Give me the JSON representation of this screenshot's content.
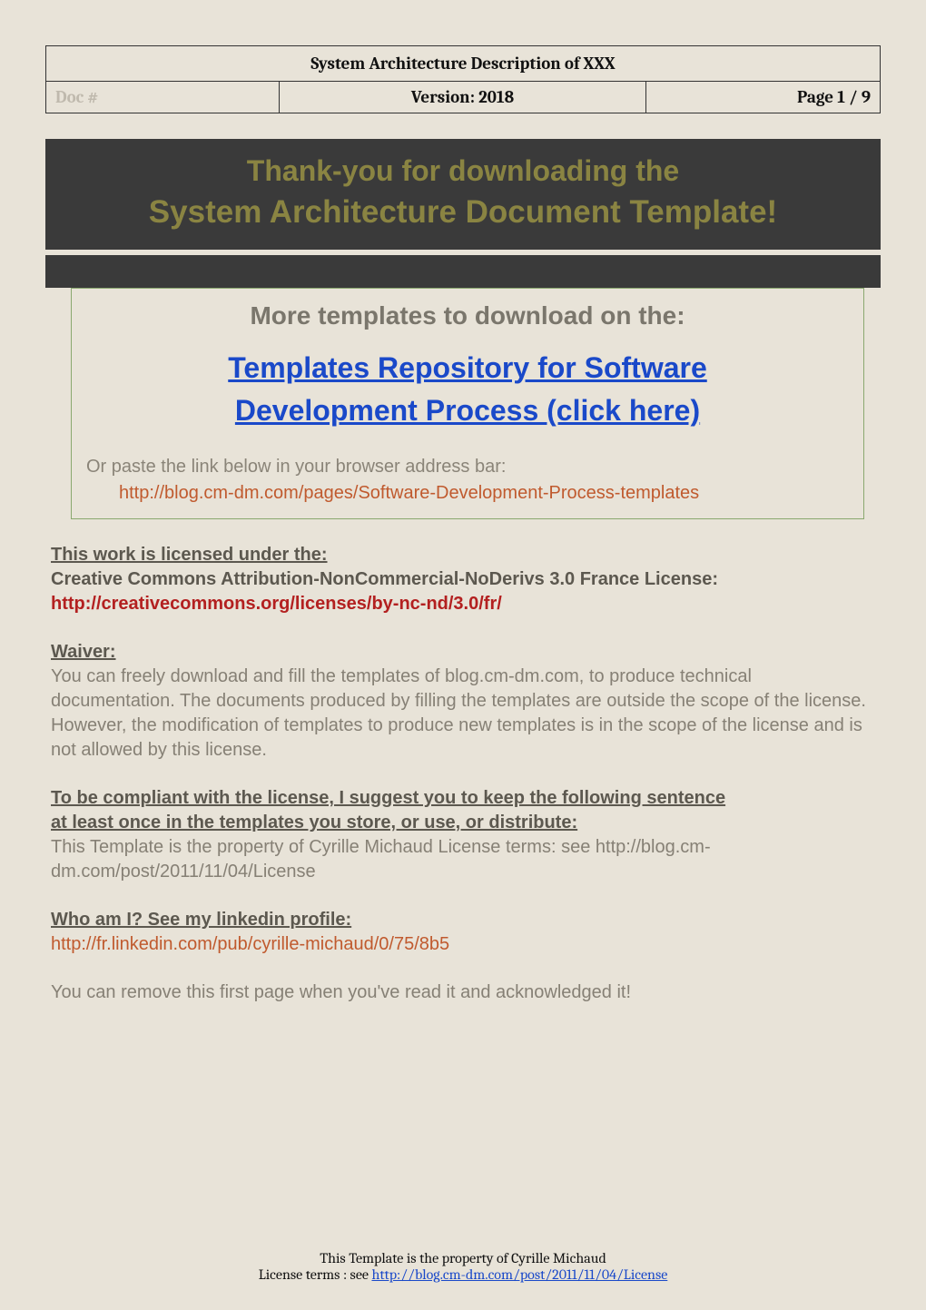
{
  "header": {
    "title": "System Architecture Description of XXX",
    "doc_label": "Doc #",
    "version_label": "Version:",
    "version_value": "2018",
    "page_label": "Page",
    "page_value": "1 / 9"
  },
  "banner": {
    "line1": "Thank-you for downloading the",
    "line2": "System Architecture Document Template!"
  },
  "callout": {
    "title": "More templates to download on the:",
    "link_line1": "Templates Repository for Software",
    "link_line2": "Development Process (click here)",
    "sub": "Or paste the link below in your browser address bar:",
    "url": "http://blog.cm-dm.com/pages/Software-Development-Process-templates"
  },
  "license": {
    "heading": "This work is licensed under the:",
    "name": "Creative Commons Attribution-NonCommercial-NoDerivs 3.0 France License:",
    "url": "http://creativecommons.org/licenses/by-nc-nd/3.0/fr/"
  },
  "waiver": {
    "heading": "Waiver:",
    "text": "You can freely download and fill the templates of blog.cm-dm.com, to produce technical documentation. The documents produced by filling the templates are outside the scope of the license. However, the modification of templates to produce new templates is in the scope of the license and is not allowed by this license."
  },
  "compliance": {
    "heading_l1": "To be compliant with the license, I suggest you to keep the following sentence",
    "heading_l2": "at least once in the templates you store, or use, or distribute:",
    "text": "This Template is the property of Cyrille Michaud License terms: see http://blog.cm-dm.com/post/2011/11/04/License"
  },
  "who": {
    "heading": "Who am I? See my linkedin profile:",
    "url": "http://fr.linkedin.com/pub/cyrille-michaud/0/75/8b5"
  },
  "remove_note": "You can remove this first page when you've read it and acknowledged it!",
  "footer": {
    "line1": "This Template is the property of Cyrille Michaud",
    "line2_prefix": "License terms : see ",
    "line2_link": "http://blog.cm-dm.com/post/2011/11/04/License"
  }
}
